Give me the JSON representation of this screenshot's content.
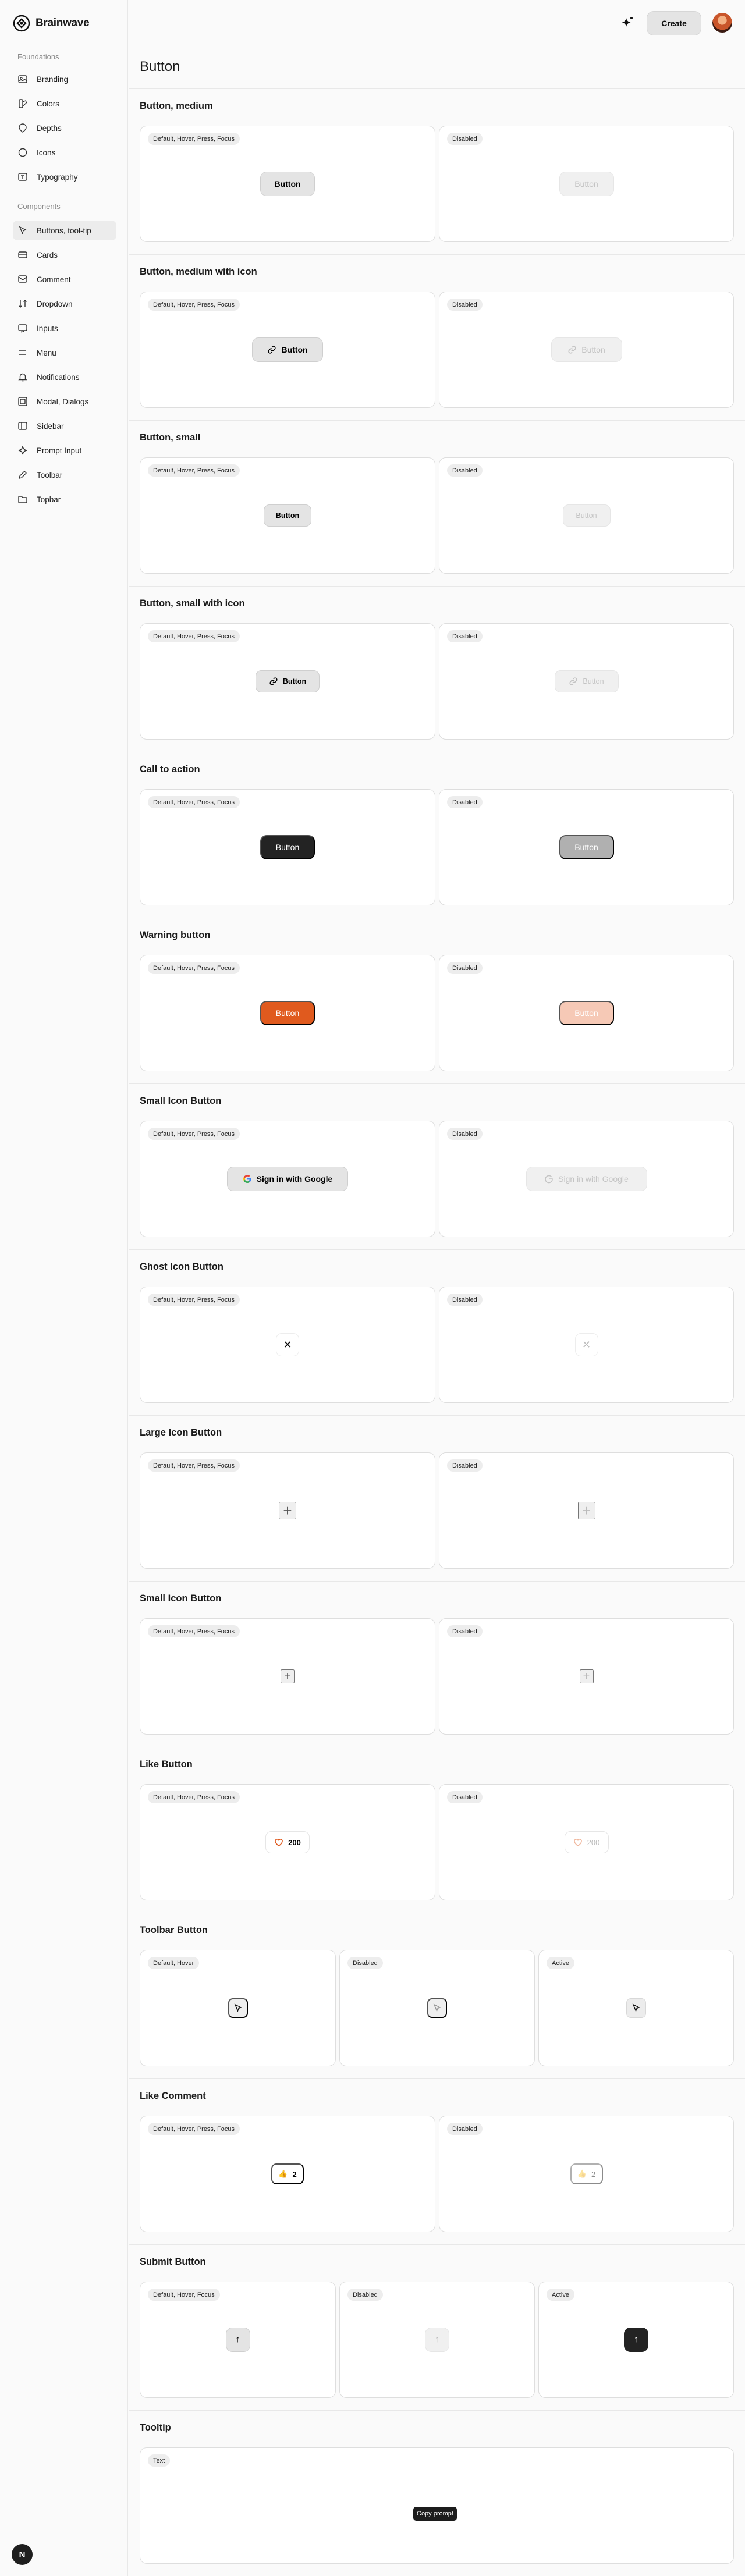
{
  "app": {
    "name": "Brainwave"
  },
  "topbar": {
    "create_label": "Create"
  },
  "sidebar": {
    "foundations_label": "Foundations",
    "components_label": "Components",
    "foundations": [
      {
        "label": "Branding",
        "icon": "image-icon"
      },
      {
        "label": "Colors",
        "icon": "palette-icon"
      },
      {
        "label": "Depths",
        "icon": "layers-icon"
      },
      {
        "label": "Icons",
        "icon": "circle-icon"
      },
      {
        "label": "Typography",
        "icon": "text-icon"
      }
    ],
    "components": [
      {
        "label": "Buttons, tool-tip",
        "icon": "cursor-icon",
        "active": true
      },
      {
        "label": "Cards",
        "icon": "card-icon"
      },
      {
        "label": "Comment",
        "icon": "message-icon"
      },
      {
        "label": "Dropdown",
        "icon": "sort-icon"
      },
      {
        "label": "Inputs",
        "icon": "input-icon"
      },
      {
        "label": "Menu",
        "icon": "menu-icon"
      },
      {
        "label": "Notifications",
        "icon": "bell-icon"
      },
      {
        "label": "Modal, Dialogs",
        "icon": "modal-icon"
      },
      {
        "label": "Sidebar",
        "icon": "sidebar-icon"
      },
      {
        "label": "Prompt Input",
        "icon": "sparkle-icon"
      },
      {
        "label": "Toolbar",
        "icon": "pen-icon"
      },
      {
        "label": "Topbar",
        "icon": "folder-icon"
      }
    ],
    "user_initial": "N"
  },
  "page": {
    "title": "Button"
  },
  "sections": {
    "button_medium": {
      "title": "Button, medium",
      "states": [
        "Default, Hover, Press, Focus",
        "Disabled"
      ],
      "label": "Button"
    },
    "button_medium_icon": {
      "title": "Button, medium with icon",
      "states": [
        "Default, Hover, Press, Focus",
        "Disabled"
      ],
      "label": "Button",
      "icon": "link-icon"
    },
    "button_small": {
      "title": "Button, small",
      "states": [
        "Default, Hover, Press, Focus",
        "Disabled"
      ],
      "label": "Button"
    },
    "button_small_icon": {
      "title": "Button, small with icon",
      "states": [
        "Default, Hover, Press, Focus",
        "Disabled"
      ],
      "label": "Button",
      "icon": "link-icon"
    },
    "cta": {
      "title": "Call to action",
      "states": [
        "Default, Hover, Press, Focus",
        "Disabled"
      ],
      "label": "Button"
    },
    "warning": {
      "title": "Warning button",
      "states": [
        "Default, Hover, Press, Focus",
        "Disabled"
      ],
      "label": "Button",
      "color": "#e05a1e"
    },
    "small_icon_google": {
      "title": "Small Icon Button",
      "states": [
        "Default, Hover, Press, Focus",
        "Disabled"
      ],
      "label": "Sign in with Google",
      "icon": "google-icon"
    },
    "ghost_icon": {
      "title": "Ghost Icon Button",
      "states": [
        "Default, Hover, Press, Focus",
        "Disabled"
      ],
      "glyph": "✕",
      "icon": "close-icon"
    },
    "large_icon": {
      "title": "Large Icon Button",
      "states": [
        "Default, Hover, Press, Focus",
        "Disabled"
      ],
      "glyph": "+",
      "icon": "plus-icon"
    },
    "small_icon": {
      "title": "Small Icon Button",
      "states": [
        "Default, Hover, Press, Focus",
        "Disabled"
      ],
      "glyph": "+",
      "icon": "plus-icon"
    },
    "like": {
      "title": "Like Button",
      "states": [
        "Default, Hover, Press, Focus",
        "Disabled"
      ],
      "count": "200",
      "icon": "heart-icon"
    },
    "toolbar": {
      "title": "Toolbar Button",
      "states": [
        "Default, Hover",
        "Disabled",
        "Active"
      ],
      "icon": "cursor-icon"
    },
    "like_comment": {
      "title": "Like Comment",
      "states": [
        "Default, Hover, Press, Focus",
        "Disabled"
      ],
      "count": "2",
      "emoji": "👍"
    },
    "submit": {
      "title": "Submit Button",
      "states": [
        "Default, Hover, Focus",
        "Disabled",
        "Active"
      ],
      "glyph": "↑",
      "icon": "arrow-up-icon"
    },
    "tooltip": {
      "title": "Tooltip",
      "states": [
        "Text"
      ],
      "text": "Copy prompt"
    }
  }
}
